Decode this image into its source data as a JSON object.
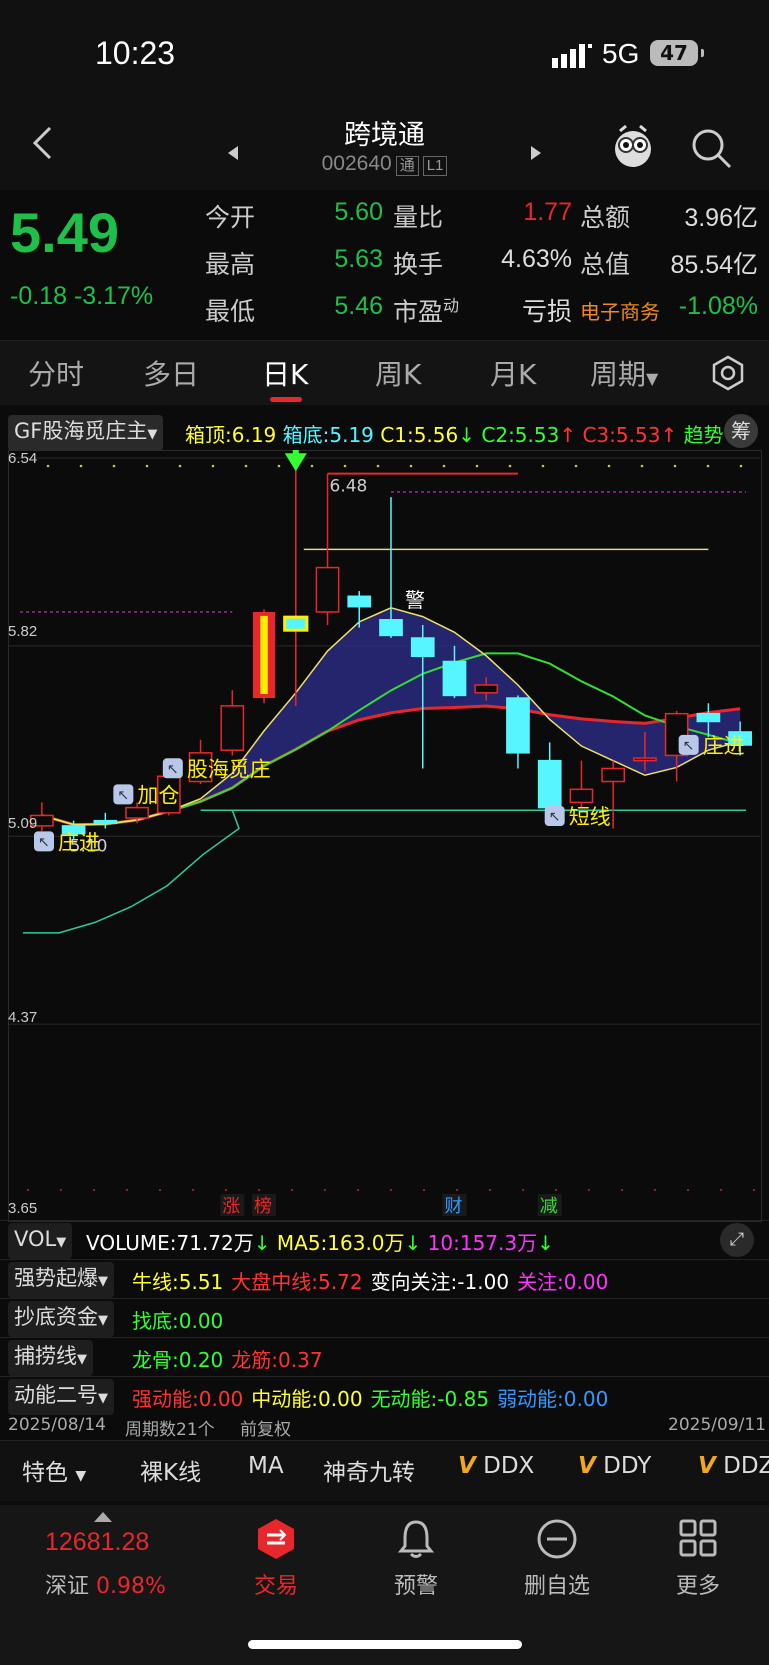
{
  "status": {
    "time": "10:23",
    "network": "5G",
    "battery": "47"
  },
  "header": {
    "title": "跨境通",
    "code": "002640",
    "badge1": "通",
    "badge2": "L1"
  },
  "quote": {
    "price": "5.49",
    "change": "-0.18",
    "change_pct": "-3.17%",
    "open_label": "今开",
    "open": "5.60",
    "high_label": "最高",
    "high": "5.63",
    "low_label": "最低",
    "low": "5.46",
    "vratio_label": "量比",
    "vratio": "1.77",
    "turnover_label": "换手",
    "turnover": "4.63%",
    "pe_label": "市盈",
    "pe_sup": "动",
    "pe": "亏损",
    "amount_label": "总额",
    "amount": "3.96亿",
    "mcap_label": "总值",
    "mcap": "85.54亿",
    "sector": "电子商务",
    "sector_pct": "-1.08%"
  },
  "tabs": [
    "分时",
    "多日",
    "日K",
    "周K",
    "月K",
    "周期"
  ],
  "indicator": {
    "name": "GF股海觅庄主",
    "box_top": "箱顶:6.19",
    "box_bottom": "箱底:5.19",
    "c1": "C1:5.56",
    "c2": "C2:5.53",
    "c3": "C3:5.53",
    "trend": "趋势",
    "chip": "筹"
  },
  "chart_data": {
    "type": "candlestick",
    "ylim": [
      3.65,
      6.54
    ],
    "y_ticks": [
      "6.54",
      "5.82",
      "5.09",
      "4.37",
      "3.65"
    ],
    "max_label": "6.48",
    "min_label": "5.10",
    "annotations": [
      "股海觅庄",
      "加仓",
      "庄进",
      "短线",
      "庄进",
      "警"
    ],
    "markers": [
      "涨",
      "榜",
      "财",
      "减"
    ],
    "candles": [
      {
        "o": 5.13,
        "c": 5.17,
        "h": 5.22,
        "l": 5.11
      },
      {
        "o": 5.13,
        "c": 5.1,
        "h": 5.15,
        "l": 5.08
      },
      {
        "o": 5.15,
        "c": 5.14,
        "h": 5.18,
        "l": 5.12
      },
      {
        "o": 5.16,
        "c": 5.2,
        "h": 5.22,
        "l": 5.14
      },
      {
        "o": 5.18,
        "c": 5.32,
        "h": 5.33,
        "l": 5.17
      },
      {
        "o": 5.3,
        "c": 5.41,
        "h": 5.46,
        "l": 5.29
      },
      {
        "o": 5.42,
        "c": 5.59,
        "h": 5.65,
        "l": 5.4
      },
      {
        "o": 5.62,
        "c": 5.95,
        "h": 5.96,
        "l": 5.6
      },
      {
        "o": 5.88,
        "c": 5.93,
        "h": 6.52,
        "l": 5.59
      },
      {
        "o": 5.95,
        "c": 6.12,
        "h": 6.48,
        "l": 5.9
      },
      {
        "o": 6.01,
        "c": 5.97,
        "h": 6.03,
        "l": 5.89
      },
      {
        "o": 5.92,
        "c": 5.86,
        "h": 6.39,
        "l": 5.85
      },
      {
        "o": 5.85,
        "c": 5.78,
        "h": 5.9,
        "l": 5.35
      },
      {
        "o": 5.76,
        "c": 5.63,
        "h": 5.82,
        "l": 5.62
      },
      {
        "o": 5.64,
        "c": 5.67,
        "h": 5.7,
        "l": 5.61
      },
      {
        "o": 5.62,
        "c": 5.41,
        "h": 5.63,
        "l": 5.35
      },
      {
        "o": 5.38,
        "c": 5.2,
        "h": 5.45,
        "l": 5.17
      },
      {
        "o": 5.22,
        "c": 5.27,
        "h": 5.38,
        "l": 5.2
      },
      {
        "o": 5.3,
        "c": 5.35,
        "h": 5.38,
        "l": 5.12
      },
      {
        "o": 5.38,
        "c": 5.39,
        "h": 5.49,
        "l": 5.34
      },
      {
        "o": 5.4,
        "c": 5.56,
        "h": 5.57,
        "l": 5.3
      },
      {
        "o": 5.56,
        "c": 5.53,
        "h": 5.6,
        "l": 5.47
      },
      {
        "o": 5.49,
        "c": 5.44,
        "h": 5.53,
        "l": 5.4
      }
    ]
  },
  "vol": {
    "name": "VOL",
    "volume": "VOLUME:71.72万",
    "ma5": "MA5:163.0万",
    "ma10": "10:157.3万"
  },
  "rows": [
    {
      "name": "强势起爆",
      "items": [
        {
          "t": "牛线:5.51",
          "c": "#ffff33"
        },
        {
          "t": "大盘中线:5.72",
          "c": "#ff3333"
        },
        {
          "t": "变向关注:-1.00",
          "c": "#ffffff"
        },
        {
          "t": "关注:0.00",
          "c": "#ff33ff"
        }
      ]
    },
    {
      "name": "抄底资金",
      "items": [
        {
          "t": "找底:0.00",
          "c": "#33ff33"
        }
      ]
    },
    {
      "name": "捕捞线",
      "items": [
        {
          "t": "龙骨:0.20",
          "c": "#33ff33"
        },
        {
          "t": "龙筋:0.37",
          "c": "#ff3333"
        }
      ]
    },
    {
      "name": "动能二号",
      "items": [
        {
          "t": "强动能:0.00",
          "c": "#ff3333"
        },
        {
          "t": "中动能:0.00",
          "c": "#ffff33"
        },
        {
          "t": "无动能:-0.85",
          "c": "#33ff33"
        },
        {
          "t": "弱动能:0.00",
          "c": "#3399ff"
        }
      ]
    }
  ],
  "dates": {
    "start": "2025/08/14",
    "period": "周期数21个",
    "adjust": "前复权",
    "end": "2025/09/11"
  },
  "bottom_tabs": [
    "特色",
    "裸K线",
    "MA",
    "神奇九转",
    "DDX",
    "DDY",
    "DDZ"
  ],
  "footer": {
    "index_value": "12681.28",
    "index_name": "深证",
    "index_pct": "0.98%",
    "trade": "交易",
    "alert": "预警",
    "remove": "删自选",
    "more": "更多"
  },
  "colors": {
    "up": "#e8272c",
    "down": "#1fc04a",
    "cyan": "#55f6ff",
    "accent": "#e8272c"
  }
}
